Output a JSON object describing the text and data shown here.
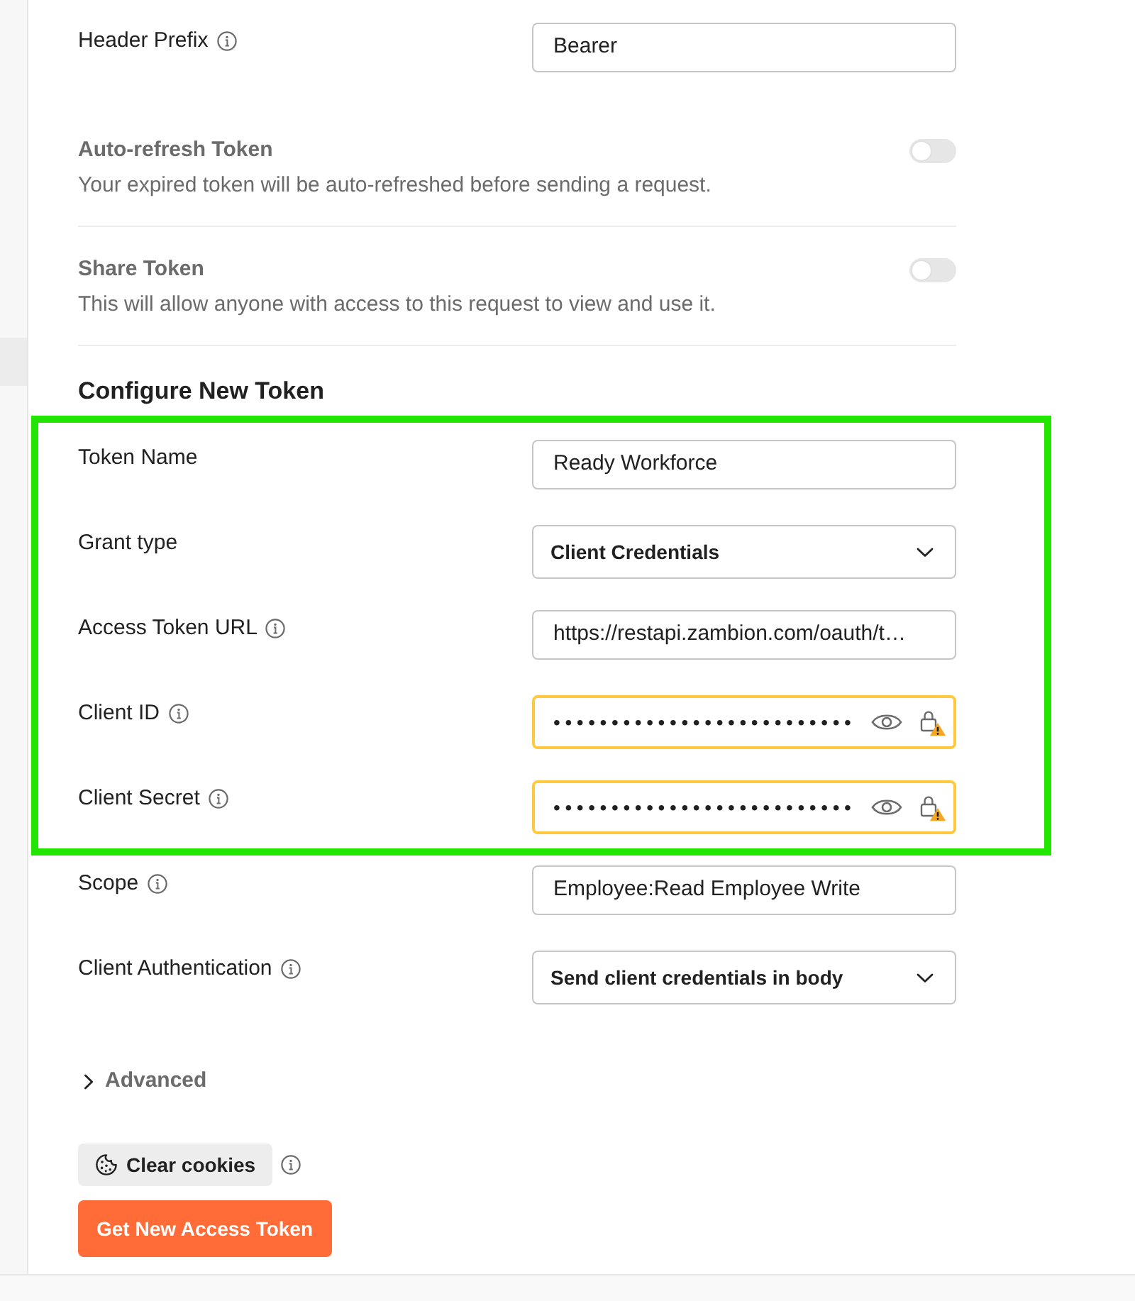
{
  "top_fields": [
    {
      "kind": "text",
      "label": "Header Prefix",
      "info": true,
      "value": "Bearer"
    }
  ],
  "toggles": [
    {
      "title": "Auto-refresh Token",
      "description": "Your expired token will be auto-refreshed before sending a request.",
      "on": false
    },
    {
      "title": "Share Token",
      "description": "This will allow anyone with access to this request to view and use it.",
      "on": false
    }
  ],
  "section": {
    "heading": "Configure New Token",
    "fields": [
      {
        "kind": "text",
        "label": "Token Name",
        "info": false,
        "value": "Ready Workforce",
        "highlighted": true
      },
      {
        "kind": "select",
        "label": "Grant type",
        "info": false,
        "value": "Client Credentials",
        "highlighted": true
      },
      {
        "kind": "text",
        "label": "Access Token URL",
        "info": true,
        "value": "https://restapi.zambion.com/oauth/t…",
        "highlighted": true
      },
      {
        "kind": "secret",
        "label": "Client ID",
        "info": true,
        "value": "••••••••••••••••••••••••••",
        "warning": true,
        "highlighted": true
      },
      {
        "kind": "secret",
        "label": "Client Secret",
        "info": true,
        "value": "••••••••••••••••••••••••••",
        "warning": true,
        "highlighted": true
      },
      {
        "kind": "text",
        "label": "Scope",
        "info": true,
        "value": "Employee:Read Employee Write",
        "highlighted": false
      },
      {
        "kind": "select",
        "label": "Client Authentication",
        "info": true,
        "value": "Send client credentials in body",
        "highlighted": false
      }
    ]
  },
  "advanced": {
    "label": "Advanced",
    "expanded": false
  },
  "clear_cookies": {
    "label": "Clear cookies",
    "info": true
  },
  "primary_button": {
    "label": "Get New Access Token"
  }
}
